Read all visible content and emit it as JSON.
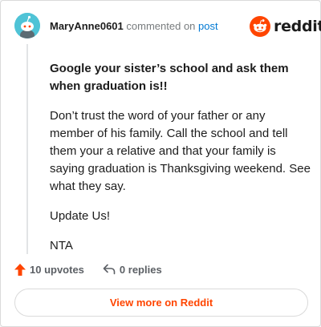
{
  "comment": {
    "username": "MaryAnne0601",
    "action_text": "commented on",
    "post_link": "post",
    "paragraphs": [
      "Google your sister’s school and ask them when graduation is!!",
      "Don’t trust the word of your father or any member of his family. Call the school and tell them your a relative and that your family is saying graduation is Thanksgiving weekend. See what they say.",
      "Update Us!",
      "NTA"
    ]
  },
  "brand": {
    "word": "reddit",
    "icon": "reddit-snoo-icon",
    "color": "#ff4500"
  },
  "actions": {
    "upvotes_label": "10 upvotes",
    "upvote_icon": "upvote-arrow-icon",
    "replies_label": "0 replies",
    "reply_icon": "reply-arrow-icon"
  },
  "footer": {
    "view_more_label": "View more on Reddit"
  },
  "colors": {
    "accent": "#ff4500",
    "link": "#0079d3",
    "avatar": "#4fc3d6"
  }
}
